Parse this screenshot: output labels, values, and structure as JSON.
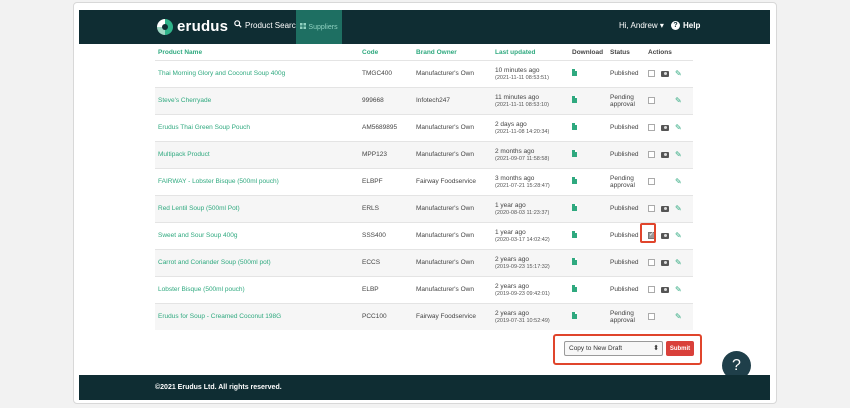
{
  "nav": {
    "logo": "erudus",
    "product_search": "Product Search",
    "suppliers": "Suppliers",
    "user": "Hi, Andrew ▾",
    "help": "Help"
  },
  "table": {
    "headers": [
      "Product Name",
      "Code",
      "Brand Owner",
      "Last updated",
      "Download",
      "Status",
      "Actions"
    ],
    "rows": [
      {
        "name": "Thai Morning Glory and Coconut Soup 400g",
        "code": "TMGC400",
        "brand": "Manufacturer's Own",
        "updated": "10 minutes ago",
        "updated_ts": "(2021-11-11 08:53:51)",
        "status": "Published"
      },
      {
        "name": "Steve's Cherryade",
        "code": "999668",
        "brand": "Infotech247",
        "updated": "11 minutes ago",
        "updated_ts": "(2021-11-11 08:53:10)",
        "status": "Pending approval"
      },
      {
        "name": "Erudus Thai Green Soup Pouch",
        "code": "AM5689895",
        "brand": "Manufacturer's Own",
        "updated": "2 days ago",
        "updated_ts": "(2021-11-08 14:20:34)",
        "status": "Published"
      },
      {
        "name": "Multipack Product",
        "code": "MPP123",
        "brand": "Manufacturer's Own",
        "updated": "2 months ago",
        "updated_ts": "(2021-09-07 11:58:58)",
        "status": "Published"
      },
      {
        "name": "FAIRWAY - Lobster Bisque (500ml pouch)",
        "code": "ELBPF",
        "brand": "Fairway Foodservice",
        "updated": "3 months ago",
        "updated_ts": "(2021-07-21 15:28:47)",
        "status": "Pending approval"
      },
      {
        "name": "Red Lentil Soup (500ml Pot)",
        "code": "ERLS",
        "brand": "Manufacturer's Own",
        "updated": "1 year ago",
        "updated_ts": "(2020-08-03 11:23:37)",
        "status": "Published"
      },
      {
        "name": "Sweet and Sour Soup 400g",
        "code": "SSS400",
        "brand": "Manufacturer's Own",
        "updated": "1 year ago",
        "updated_ts": "(2020-03-17 14:02:42)",
        "status": "Published"
      },
      {
        "name": "Carrot and Coriander Soup (500ml pot)",
        "code": "ECCS",
        "brand": "Manufacturer's Own",
        "updated": "2 years ago",
        "updated_ts": "(2019-09-23 15:17:32)",
        "status": "Published"
      },
      {
        "name": "Lobster Bisque (500ml pouch)",
        "code": "ELBP",
        "brand": "Manufacturer's Own",
        "updated": "2 years ago",
        "updated_ts": "(2019-09-23 09:42:01)",
        "status": "Published"
      },
      {
        "name": "Erudus for Soup - Creamed Coconut 198G",
        "code": "PCC100",
        "brand": "Fairway Foodservice",
        "updated": "2 years ago",
        "updated_ts": "(2019-07-31 10:52:49)",
        "status": "Pending approval"
      }
    ]
  },
  "bulk": {
    "selected": "Copy to New Draft",
    "submit": "Submit"
  },
  "help_fab": "?",
  "footer": "©2021 Erudus Ltd. All rights reserved."
}
